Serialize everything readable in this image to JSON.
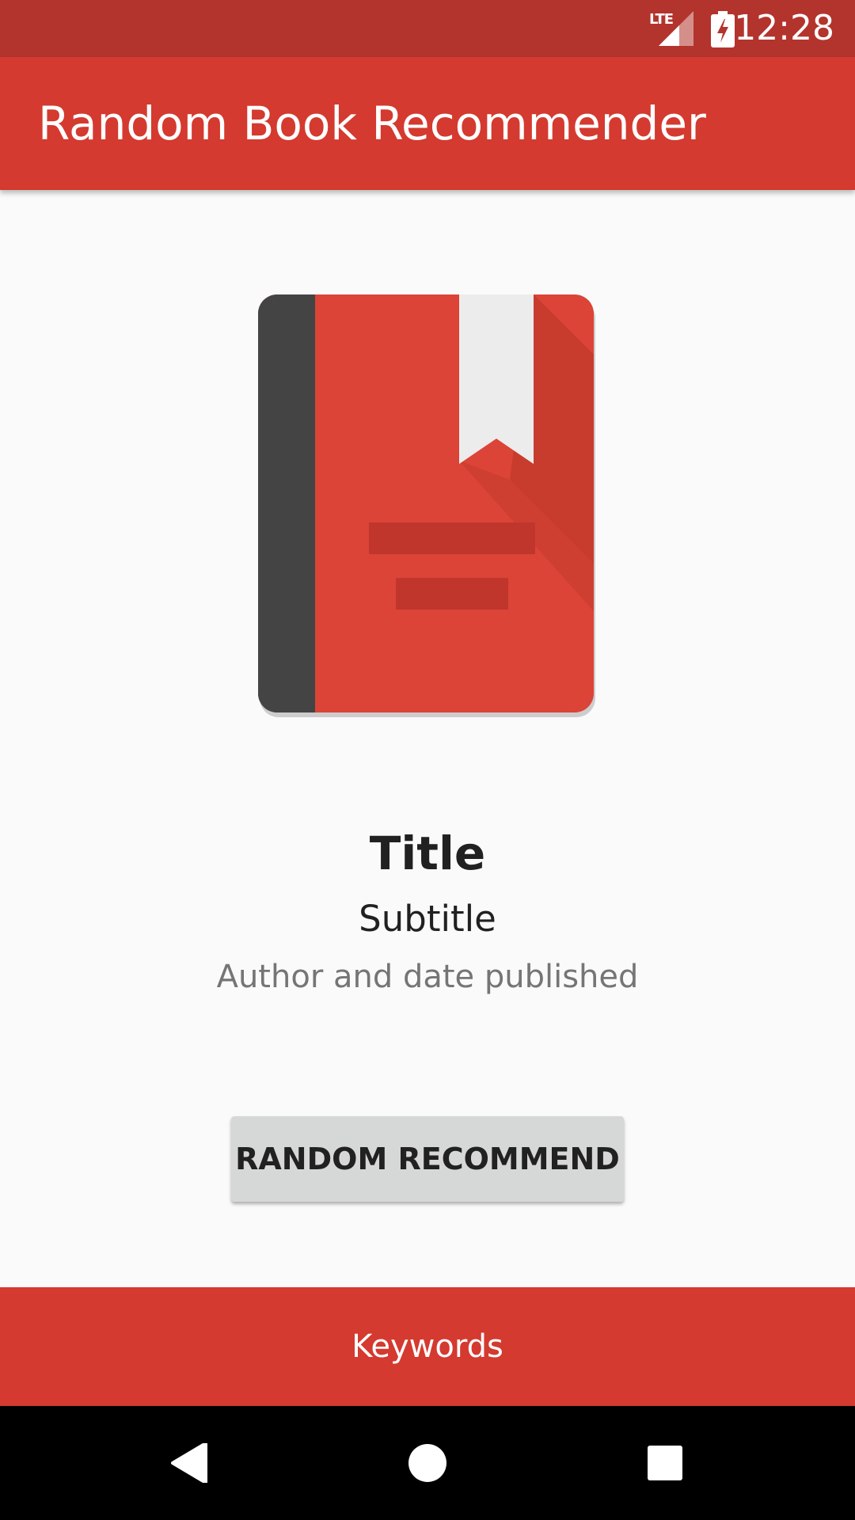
{
  "status_bar": {
    "time": "12:28",
    "network": "LTE",
    "icons": [
      "lte-signal-icon",
      "battery-charging-icon"
    ]
  },
  "app_bar": {
    "title": "Random Book Recommender"
  },
  "book": {
    "title": "Title",
    "subtitle": "Subtitle",
    "author_date": "Author and date published",
    "image_icon": "book-icon"
  },
  "actions": {
    "random_label": "RANDOM RECOMMEND",
    "keywords_label": "Keywords"
  },
  "nav_bar": {
    "icons": [
      "back-icon",
      "home-icon",
      "recents-icon"
    ]
  },
  "colors": {
    "status_bar": "#b3342d",
    "primary": "#d43a2f",
    "background": "#fafafa",
    "button": "#d6d7d7"
  }
}
